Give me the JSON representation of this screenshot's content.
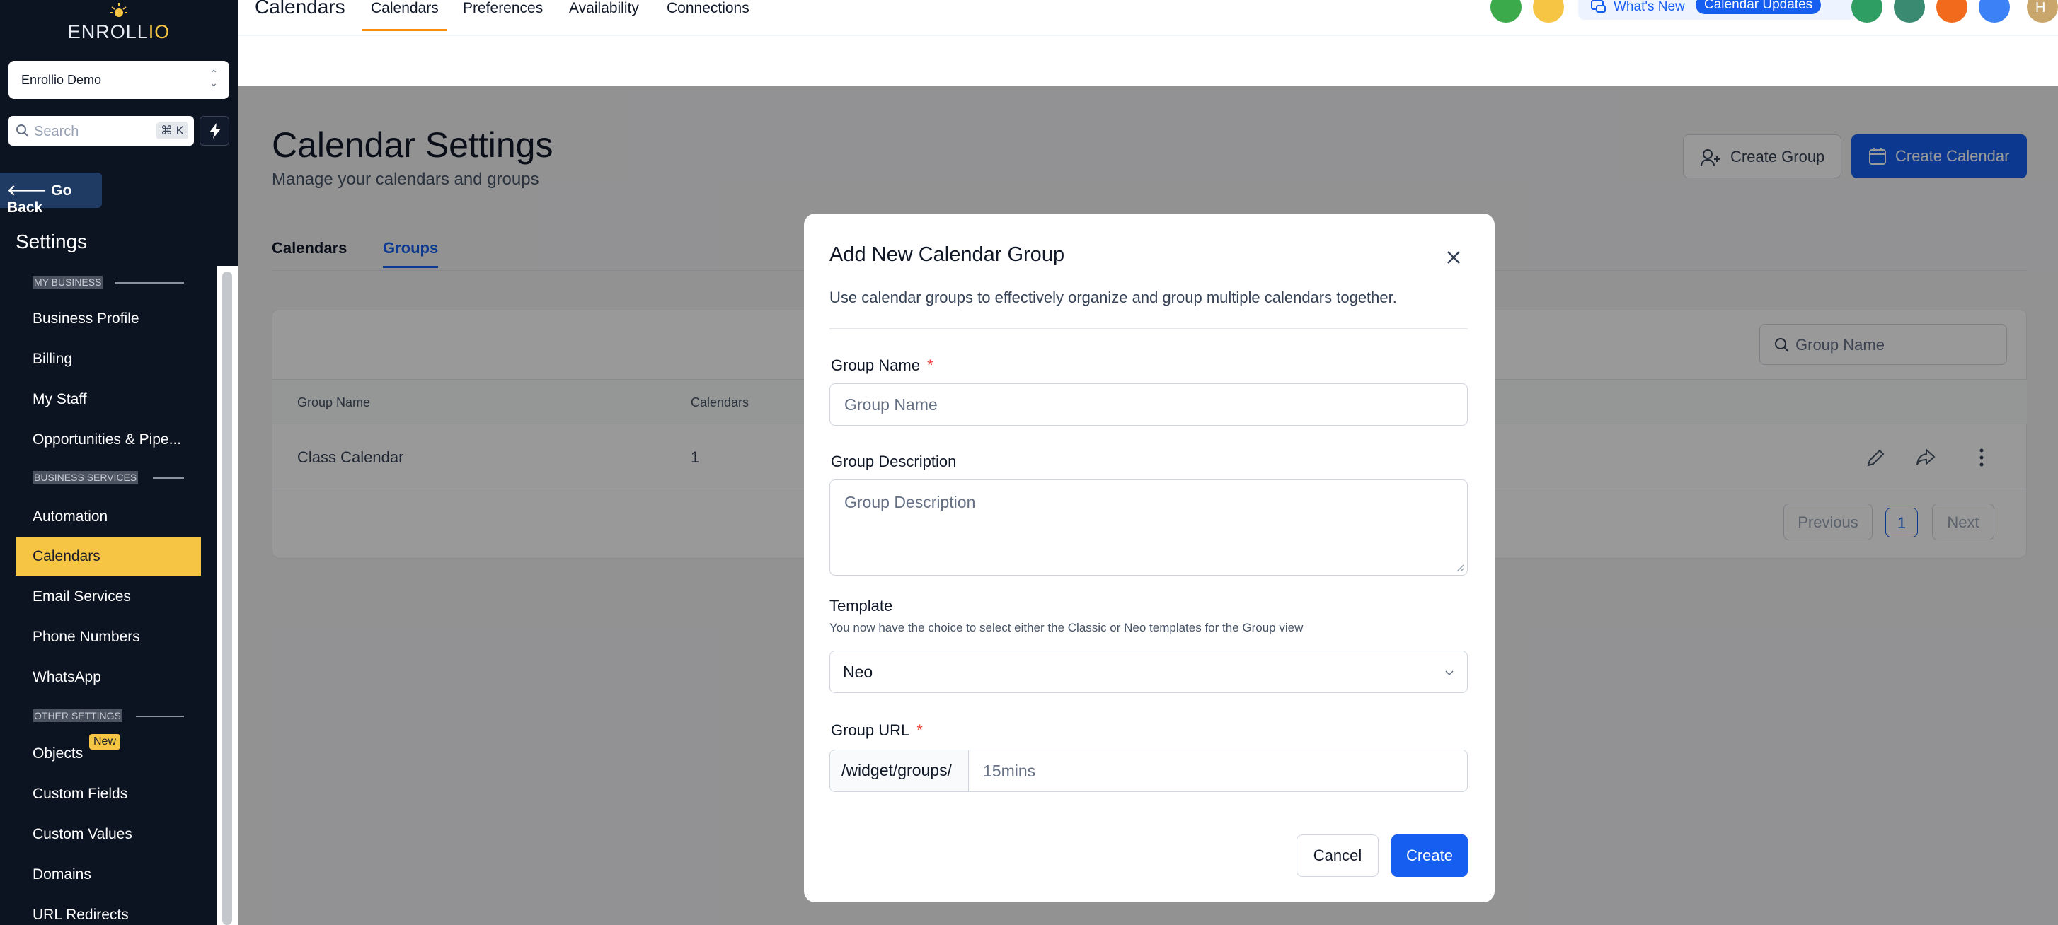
{
  "sidebar": {
    "brand": {
      "main": "ENROLL",
      "accent": "IO"
    },
    "account": "Enrollio Demo",
    "search_placeholder": "Search",
    "search_shortcut": "⌘ K",
    "go_back": "Go Back",
    "settings_title": "Settings",
    "sections": {
      "my_business": "MY BUSINESS",
      "business_services": "BUSINESS SERVICES",
      "other_settings": "OTHER SETTINGS"
    },
    "items": {
      "business_profile": "Business Profile",
      "billing": "Billing",
      "my_staff": "My Staff",
      "opportunities": "Opportunities & Pipe...",
      "automation": "Automation",
      "calendars": "Calendars",
      "email_services": "Email Services",
      "phone_numbers": "Phone Numbers",
      "whatsapp": "WhatsApp",
      "objects": "Objects",
      "objects_badge": "New",
      "custom_fields": "Custom Fields",
      "custom_values": "Custom Values",
      "domains": "Domains",
      "url_redirects": "URL Redirects"
    }
  },
  "topbar": {
    "title": "Calendars",
    "tabs": {
      "calendars": "Calendars",
      "preferences": "Preferences",
      "availability": "Availability",
      "connections": "Connections"
    },
    "whats_new": "What's New",
    "calendar_updates": "Calendar Updates",
    "avatar_initials": "H"
  },
  "page": {
    "title": "Calendar Settings",
    "subtitle": "Manage your calendars and groups",
    "create_group": "Create Group",
    "create_calendar": "Create Calendar",
    "tabs": {
      "calendars": "Calendars",
      "groups": "Groups"
    },
    "search_placeholder": "Group Name",
    "table": {
      "headers": {
        "group_name": "Group Name",
        "calendars": "Calendars"
      },
      "rows": [
        {
          "group_name": "Class Calendar",
          "calendars": "1"
        }
      ]
    },
    "pagination": {
      "previous": "Previous",
      "page": "1",
      "next": "Next"
    }
  },
  "modal": {
    "title": "Add New Calendar Group",
    "description": "Use calendar groups to effectively organize and group multiple calendars together.",
    "group_name_label": "Group Name",
    "group_name_placeholder": "Group Name",
    "group_description_label": "Group Description",
    "group_description_placeholder": "Group Description",
    "template_label": "Template",
    "template_help": "You now have the choice to select either the Classic or Neo templates for the Group view",
    "template_value": "Neo",
    "group_url_label": "Group URL",
    "group_url_prefix": "/widget/groups/",
    "group_url_placeholder": "15mins",
    "required_mark": "*",
    "cancel": "Cancel",
    "create": "Create"
  },
  "colors": {
    "primary": "#155eef",
    "sidebar_bg": "#0c1321",
    "active_nav": "#f6c544",
    "tab_accent": "#f79009"
  }
}
